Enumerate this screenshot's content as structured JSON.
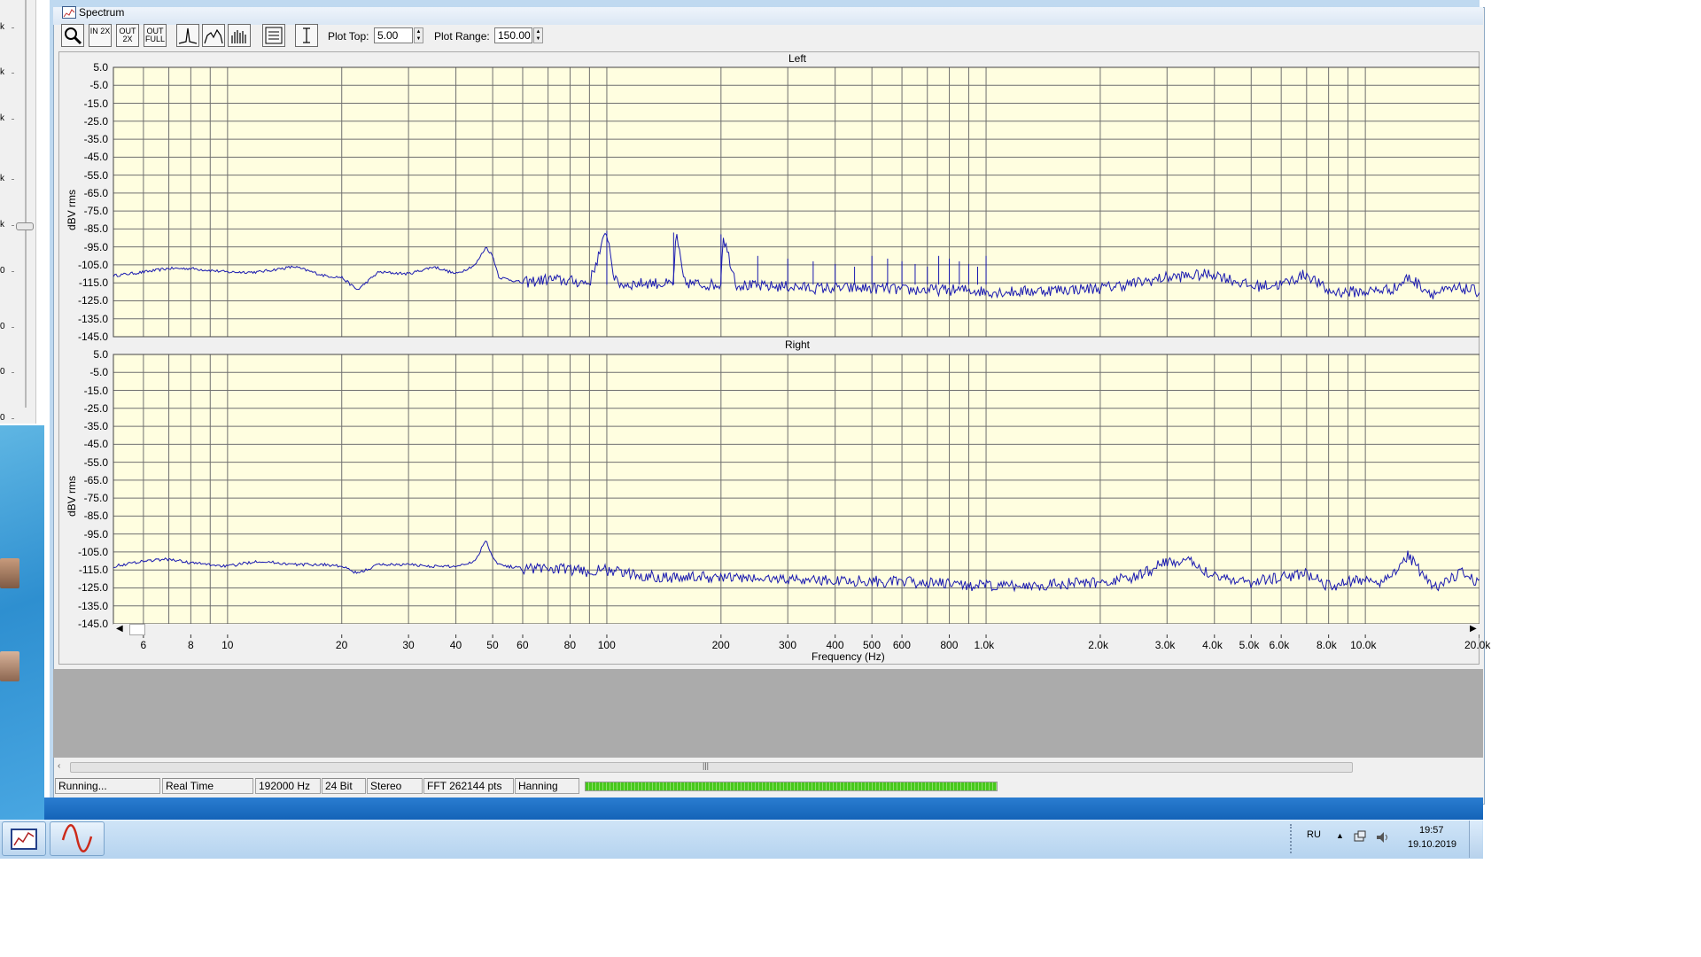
{
  "left_window": {
    "axis_labels": [
      "k",
      "k",
      "k",
      "k",
      "k",
      "0",
      "0",
      "0",
      "0",
      "0"
    ]
  },
  "window": {
    "title": "Spectrum",
    "toolbar": {
      "zoom_icon": "magnifier-icon",
      "zoom_in_2x": "IN 2X",
      "zoom_out_2x": "OUT 2X",
      "zoom_out_full": "OUT FULL",
      "plot_top_label": "Plot Top:",
      "plot_top_value": "5.00",
      "plot_range_label": "Plot Range:",
      "plot_range_value": "150.00"
    },
    "status": {
      "state": "Running...",
      "mode": "Real Time",
      "sample_rate": "192000 Hz",
      "bit_depth": "24 Bit",
      "channels": "Stereo",
      "fft_size": "FFT 262144 pts",
      "window_fn": "Hanning",
      "progress": 0.87
    },
    "scroll_grip": "|||"
  },
  "taskbar": {
    "language": "RU",
    "time": "19:57",
    "date": "19.10.2019"
  },
  "chart_data": [
    {
      "type": "line",
      "title": "Left",
      "ylabel": "dBV rms",
      "xlabel": "Frequency (Hz)",
      "xscale": "log",
      "xlim": [
        5,
        20000
      ],
      "ylim": [
        -145,
        5
      ],
      "yticks": [
        "5.0",
        "-5.0",
        "-15.0",
        "-25.0",
        "-35.0",
        "-45.0",
        "-55.0",
        "-65.0",
        "-75.0",
        "-85.0",
        "-95.0",
        "-105.0",
        "-115.0",
        "-125.0",
        "-135.0",
        "-145.0"
      ],
      "grid": true,
      "x": [
        5,
        6,
        7,
        8,
        10,
        12,
        15,
        18,
        20,
        22,
        25,
        30,
        35,
        40,
        45,
        48,
        50,
        52,
        55,
        60,
        70,
        80,
        90,
        100,
        105,
        110,
        130,
        150,
        152,
        160,
        180,
        200,
        202,
        220,
        250,
        260,
        300,
        350,
        400,
        450,
        500,
        550,
        600,
        700,
        800,
        900,
        1000,
        1200,
        1500,
        2000,
        2500,
        3000,
        3500,
        4000,
        5000,
        6000,
        7000,
        8000,
        10000,
        12000,
        13000,
        15000,
        18000,
        20000
      ],
      "y": [
        -111,
        -109,
        -107,
        -107,
        -109,
        -109,
        -106,
        -111,
        -112,
        -119,
        -109,
        -110,
        -106,
        -110,
        -105,
        -95,
        -100,
        -112,
        -113,
        -115,
        -113,
        -114,
        -115,
        -86,
        -114,
        -116,
        -115,
        -116,
        -87,
        -115,
        -116,
        -116,
        -88,
        -116,
        -117,
        -117,
        -117,
        -118,
        -118,
        -118,
        -118,
        -118,
        -119,
        -119,
        -119,
        -119,
        -120,
        -120,
        -119,
        -118,
        -115,
        -112,
        -111,
        -110,
        -117,
        -116,
        -110,
        -120,
        -120,
        -118,
        -112,
        -121,
        -118,
        -120
      ]
    },
    {
      "type": "line",
      "title": "Right",
      "ylabel": "dBV rms",
      "xlabel": "Frequency (Hz)",
      "xscale": "log",
      "xlim": [
        5,
        20000
      ],
      "ylim": [
        -145,
        5
      ],
      "yticks": [
        "5.0",
        "-5.0",
        "-15.0",
        "-25.0",
        "-35.0",
        "-45.0",
        "-55.0",
        "-65.0",
        "-75.0",
        "-85.0",
        "-95.0",
        "-105.0",
        "-115.0",
        "-125.0",
        "-135.0",
        "-145.0"
      ],
      "xticks": [
        "6",
        "8",
        "10",
        "20",
        "30",
        "40",
        "50",
        "60",
        "80",
        "100",
        "200",
        "300",
        "400",
        "500",
        "600",
        "800",
        "1.0k",
        "2.0k",
        "3.0k",
        "4.0k",
        "5.0k",
        "6.0k",
        "8.0k",
        "10.0k",
        "20.0k"
      ],
      "grid": true,
      "x": [
        5,
        6,
        7,
        8,
        10,
        12,
        15,
        18,
        20,
        22,
        25,
        30,
        35,
        40,
        45,
        48,
        50,
        52,
        55,
        60,
        70,
        80,
        90,
        100,
        120,
        150,
        200,
        250,
        300,
        400,
        500,
        600,
        700,
        800,
        1000,
        1200,
        1500,
        2000,
        2500,
        3000,
        3500,
        4000,
        5000,
        6000,
        7000,
        8000,
        10000,
        11000,
        12000,
        13000,
        15000,
        18000,
        20000
      ],
      "y": [
        -113,
        -110,
        -109,
        -111,
        -113,
        -110,
        -112,
        -112,
        -113,
        -117,
        -112,
        -112,
        -113,
        -113,
        -110,
        -98,
        -108,
        -112,
        -113,
        -114,
        -114,
        -115,
        -116,
        -115,
        -118,
        -119,
        -119,
        -120,
        -120,
        -121,
        -121,
        -122,
        -122,
        -123,
        -124,
        -124,
        -123,
        -122,
        -119,
        -110,
        -111,
        -118,
        -122,
        -119,
        -117,
        -124,
        -120,
        -122,
        -115,
        -107,
        -125,
        -117,
        -123
      ]
    }
  ]
}
